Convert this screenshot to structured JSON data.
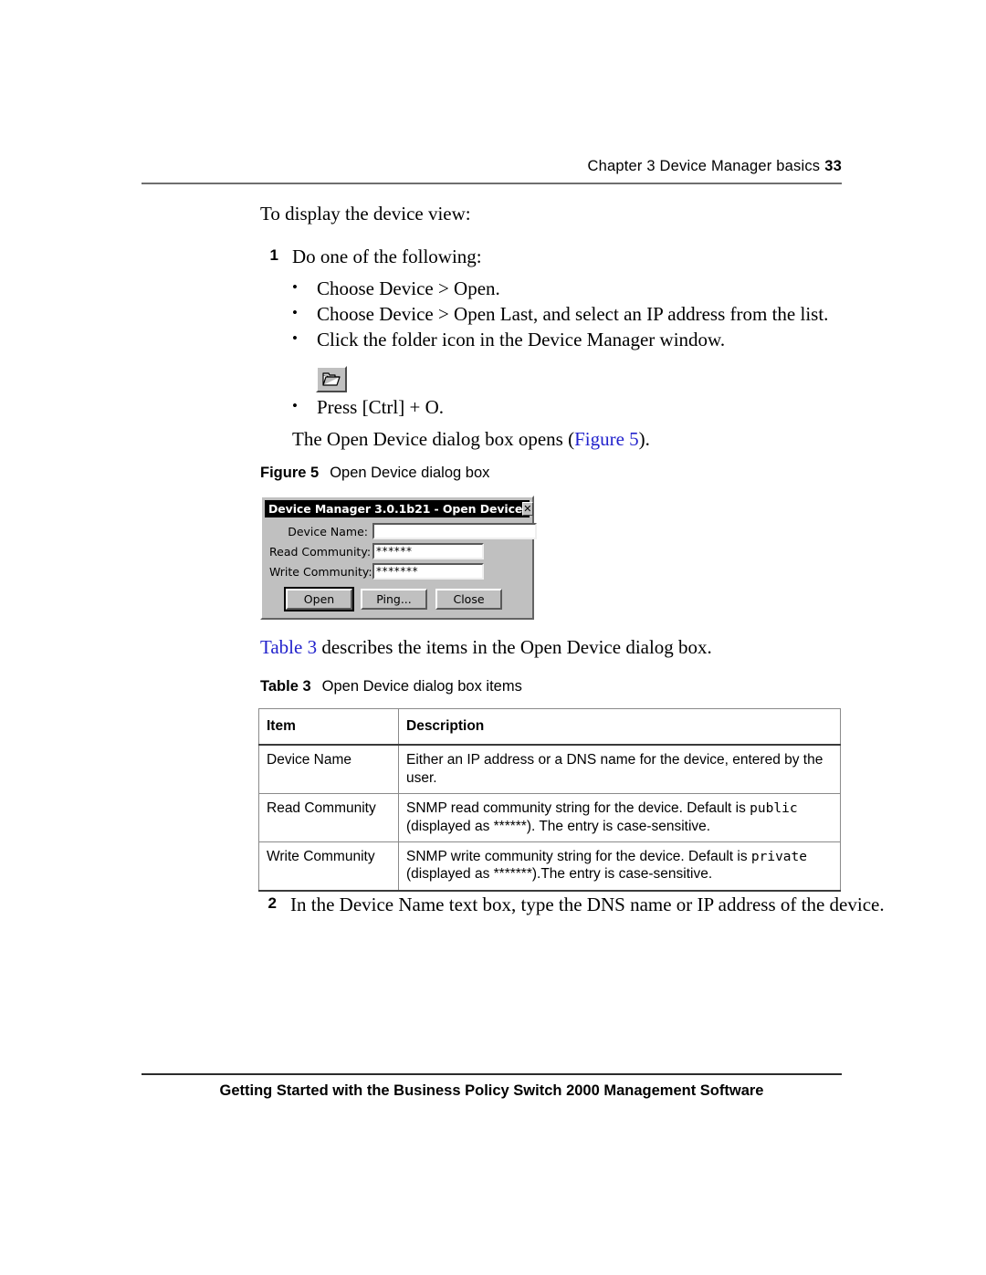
{
  "header": {
    "chapter_title": "Chapter 3  Device Manager basics",
    "page_number": "33"
  },
  "footer": {
    "text": "Getting Started with the Business Policy Switch 2000 Management Software"
  },
  "body": {
    "lead_in": "To display the device view:",
    "step_1": {
      "number": "1",
      "text": "Do one of the following:"
    },
    "bullets": [
      {
        "marker": "•",
        "text": "Choose Device > Open."
      },
      {
        "marker": "•",
        "text": "Choose Device > Open Last, and select an IP address from the list."
      },
      {
        "marker": "•",
        "text": "Click the folder icon in the Device Manager window."
      },
      {
        "marker": "•",
        "text": "Press [Ctrl] + O."
      }
    ],
    "after_bullets": {
      "before": "The Open Device dialog box opens (",
      "xref": "Figure 5",
      "after": ")."
    },
    "step_2": {
      "number": "2",
      "text": "In the Device Name text box, type the DNS name or IP address of the device."
    }
  },
  "figure": {
    "label": "Figure 5",
    "title": "Open Device dialog box"
  },
  "dialog": {
    "title": "Device Manager 3.0.1b21 - Open Device",
    "close_label": "✕",
    "fields": [
      {
        "label": "Device Name:",
        "value": ""
      },
      {
        "label": "Read Community:",
        "value": "******"
      },
      {
        "label": "Write Community:",
        "value": "*******"
      }
    ],
    "buttons": [
      {
        "label": "Open",
        "default": true
      },
      {
        "label": "Ping...",
        "default": false
      },
      {
        "label": "Close",
        "default": false
      }
    ]
  },
  "table_intro": {
    "xref": "Table 3",
    "rest": " describes the items in the Open Device dialog box."
  },
  "table_caption": {
    "label": "Table 3",
    "title": "Open Device dialog box items"
  },
  "table": {
    "columns": [
      "Item",
      "Description"
    ],
    "rows": [
      {
        "item": "Device Name",
        "description_parts": [
          {
            "text": "Either an IP address or a DNS name for the device, entered by the user.",
            "mono": false
          }
        ]
      },
      {
        "item": "Read Community",
        "description_parts": [
          {
            "text": "SNMP read community string for the device. Default is ",
            "mono": false
          },
          {
            "text": "public",
            "mono": true
          },
          {
            "text": " (displayed as ******). The entry is case-sensitive.",
            "mono": false
          }
        ]
      },
      {
        "item": "Write Community",
        "description_parts": [
          {
            "text": "SNMP write community string for the device. Default is ",
            "mono": false
          },
          {
            "text": "private",
            "mono": true
          },
          {
            "text": " (displayed as *******).The entry is case-sensitive.",
            "mono": false
          }
        ]
      }
    ]
  },
  "colors": {
    "xref_blue": "#2222cc",
    "dialog_face": "#c0c0c0",
    "titlebar": "#000000"
  }
}
